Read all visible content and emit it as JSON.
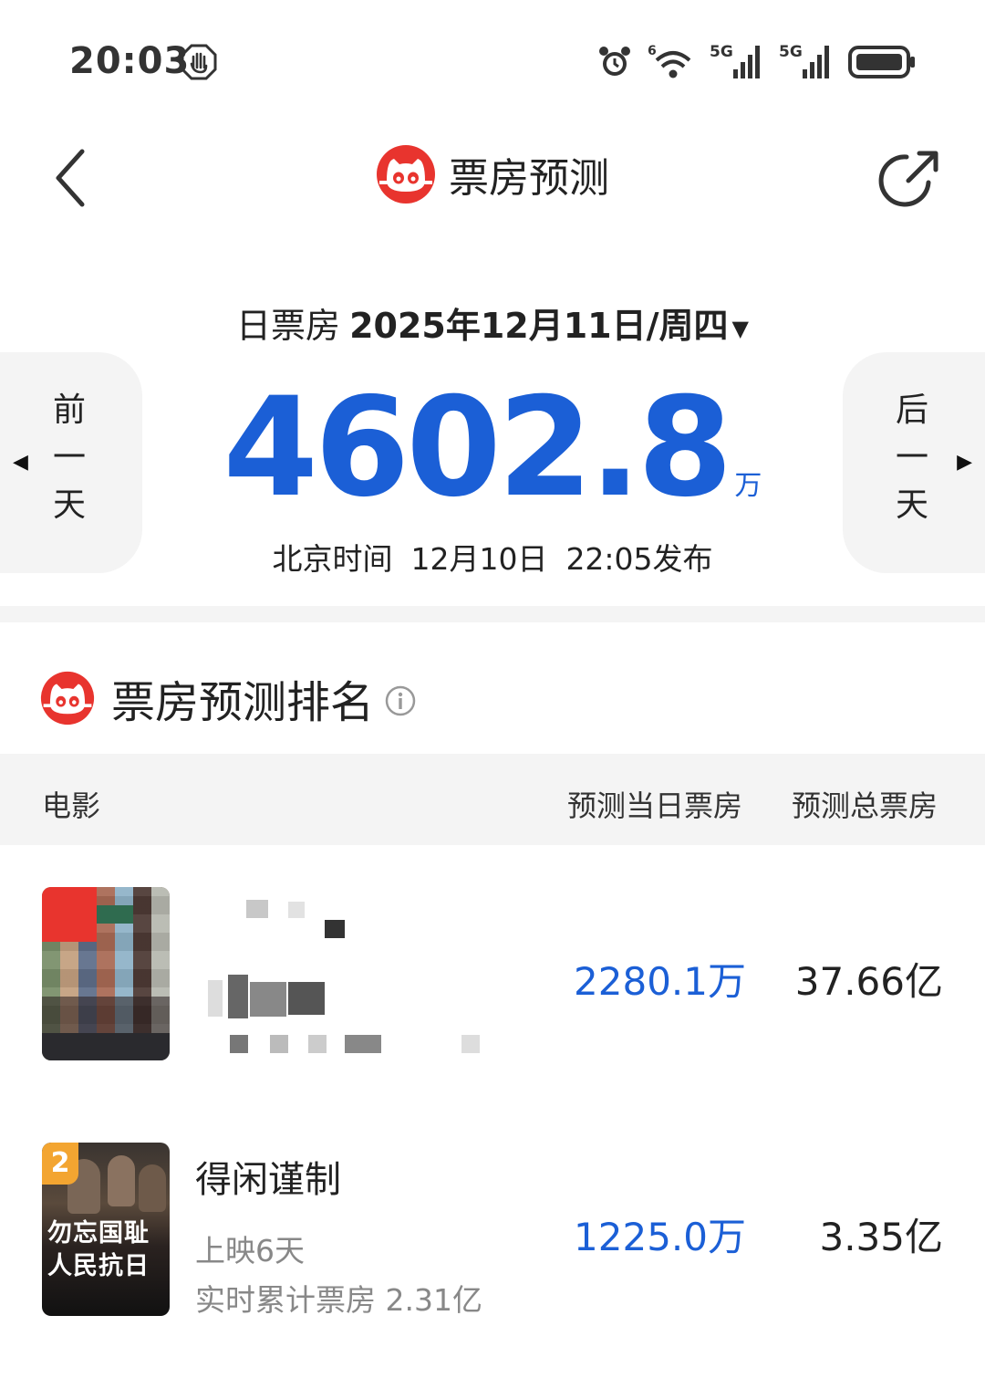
{
  "status": {
    "time": "20:03",
    "signal1": "5G",
    "signal2": "5G",
    "wifi_badge": "6"
  },
  "header": {
    "title": "票房预测",
    "back_icon": "chevron-left-icon",
    "share_icon": "share-icon",
    "logo": "maoyan-cat-logo"
  },
  "daily": {
    "label": "日票房",
    "date": "2025年12月11日/周四",
    "caret": "▼",
    "amount": "4602.8",
    "unit": "万",
    "publish_prefix": "北京时间",
    "publish_date": "12月10日",
    "publish_time": "22:05发布",
    "prev": [
      "前",
      "一",
      "天"
    ],
    "next": [
      "后",
      "一",
      "天"
    ]
  },
  "ranking": {
    "title": "票房预测排名",
    "columns": {
      "movie": "电影",
      "day": "预测当日票房",
      "total": "预测总票房"
    },
    "rows": [
      {
        "rank": "1",
        "title": "",
        "day": "2280.1万",
        "total": "37.66亿"
      },
      {
        "rank": "2",
        "title": "得闲谨制",
        "poster_text_1": "勿忘国耻",
        "poster_text_2": "人民抗日",
        "days": "上映6天",
        "realtime": "实时累计票房 2.31亿",
        "day": "1225.0万",
        "total": "3.35亿"
      }
    ]
  },
  "colors": {
    "accent": "#1b5fd6",
    "brand_red": "#e8342e",
    "rank_badge": "#f3a531",
    "panel_bg": "#f4f4f4"
  }
}
